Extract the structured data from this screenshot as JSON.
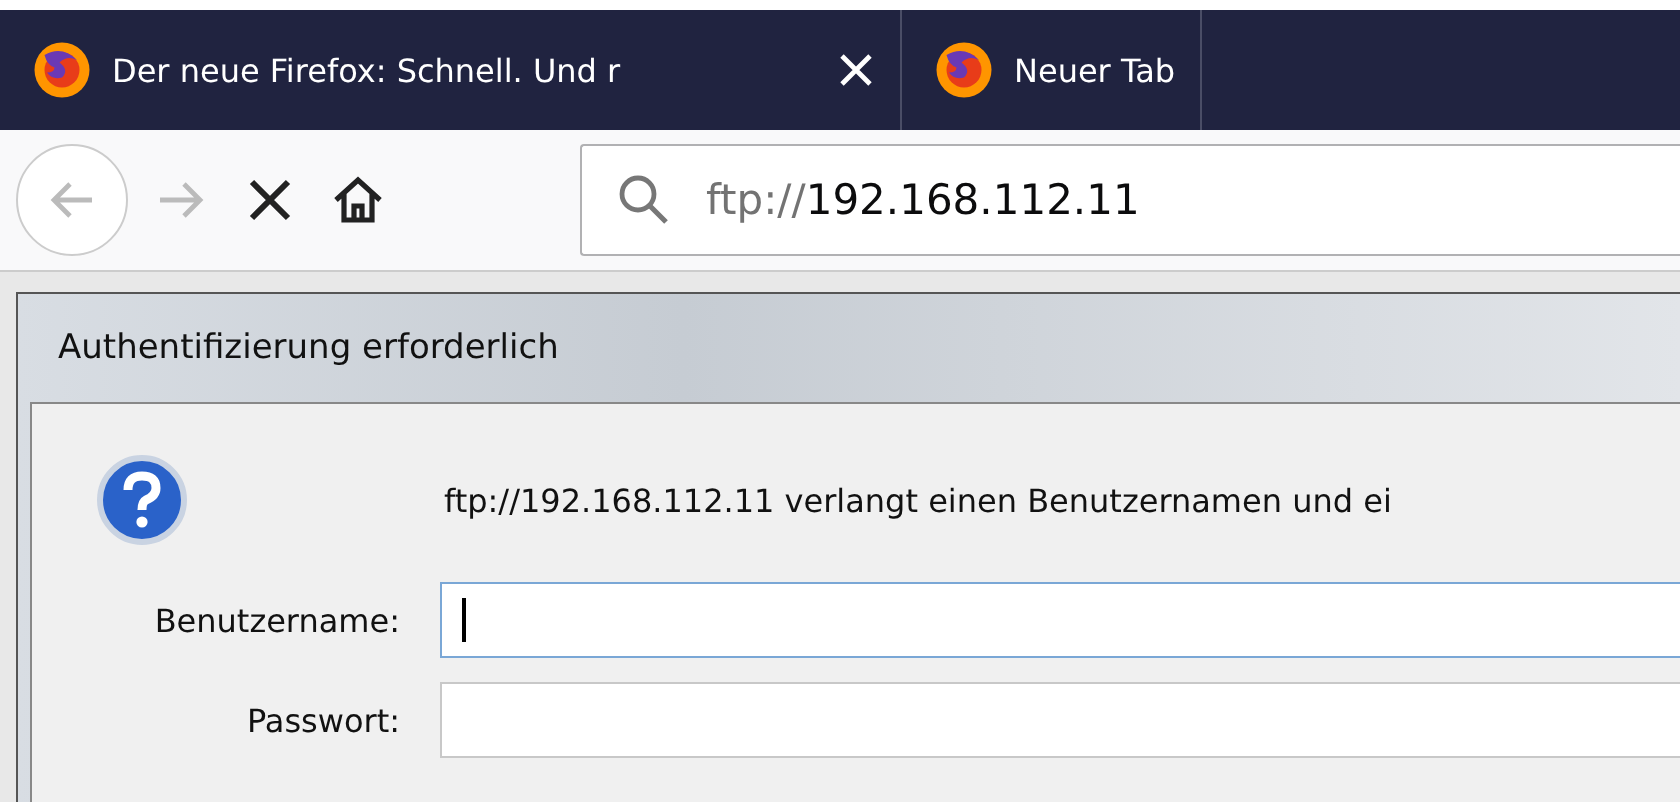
{
  "tabs": [
    {
      "title": "Der neue Firefox: Schnell. Und r",
      "closable": true
    },
    {
      "title": "Neuer Tab",
      "closable": false
    }
  ],
  "toolbar": {
    "url": {
      "scheme": "ftp://",
      "host": "192.168.112.11"
    }
  },
  "dialog": {
    "title": "Authentifizierung erforderlich",
    "message": "ftp://192.168.112.11 verlangt einen Benutzernamen und ei",
    "fields": [
      {
        "label": "Benutzername:",
        "focused": true
      },
      {
        "label": "Passwort:",
        "focused": false
      }
    ]
  }
}
